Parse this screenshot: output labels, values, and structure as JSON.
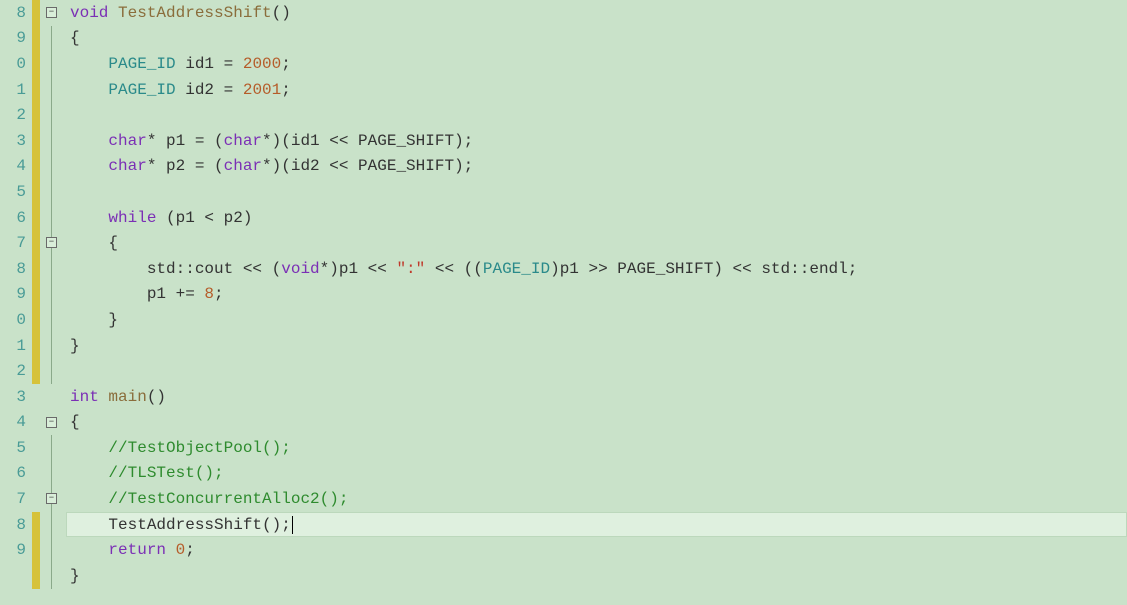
{
  "editor": {
    "line_height_px": 25.6,
    "font": "Consolas",
    "current_line_index": 21,
    "change_bar_ranges": [
      [
        0,
        14
      ],
      [
        20,
        22
      ]
    ],
    "fold_markers": [
      0,
      9,
      16,
      19
    ],
    "fold_line_ranges": [
      [
        1,
        14
      ],
      [
        10,
        13
      ],
      [
        17,
        23
      ],
      [
        20,
        23
      ]
    ],
    "lines": [
      {
        "no": "8",
        "tokens": [
          [
            "kw",
            "void"
          ],
          [
            "pun",
            " "
          ],
          [
            "func",
            "TestAddressShift"
          ],
          [
            "pun",
            "()"
          ]
        ]
      },
      {
        "no": "9",
        "tokens": [
          [
            "pun",
            "{"
          ]
        ]
      },
      {
        "no": "0",
        "tokens": [
          [
            "pun",
            "    "
          ],
          [
            "type",
            "PAGE_ID"
          ],
          [
            "pun",
            " id1 = "
          ],
          [
            "num",
            "2000"
          ],
          [
            "pun",
            ";"
          ]
        ]
      },
      {
        "no": "1",
        "tokens": [
          [
            "pun",
            "    "
          ],
          [
            "type",
            "PAGE_ID"
          ],
          [
            "pun",
            " id2 = "
          ],
          [
            "num",
            "2001"
          ],
          [
            "pun",
            ";"
          ]
        ]
      },
      {
        "no": "2",
        "tokens": []
      },
      {
        "no": "3",
        "tokens": [
          [
            "pun",
            "    "
          ],
          [
            "kw",
            "char"
          ],
          [
            "pun",
            "* p1 = ("
          ],
          [
            "kw",
            "char"
          ],
          [
            "pun",
            "*)(id1 << PAGE_SHIFT);"
          ]
        ]
      },
      {
        "no": "4",
        "tokens": [
          [
            "pun",
            "    "
          ],
          [
            "kw",
            "char"
          ],
          [
            "pun",
            "* p2 = ("
          ],
          [
            "kw",
            "char"
          ],
          [
            "pun",
            "*)(id2 << PAGE_SHIFT);"
          ]
        ]
      },
      {
        "no": "5",
        "tokens": []
      },
      {
        "no": "6",
        "tokens": [
          [
            "pun",
            "    "
          ],
          [
            "kw",
            "while"
          ],
          [
            "pun",
            " (p1 < p2)"
          ]
        ]
      },
      {
        "no": "7",
        "tokens": [
          [
            "pun",
            "    {"
          ]
        ]
      },
      {
        "no": "8",
        "tokens": [
          [
            "pun",
            "        std::cout << ("
          ],
          [
            "kw",
            "void"
          ],
          [
            "pun",
            "*)p1 << "
          ],
          [
            "str",
            "\":\""
          ],
          [
            "pun",
            " << (("
          ],
          [
            "type",
            "PAGE_ID"
          ],
          [
            "pun",
            ")p1 >> PAGE_SHIFT) << std::endl;"
          ]
        ]
      },
      {
        "no": "9",
        "tokens": [
          [
            "pun",
            "        p1 += "
          ],
          [
            "num",
            "8"
          ],
          [
            "pun",
            ";"
          ]
        ]
      },
      {
        "no": "0",
        "tokens": [
          [
            "pun",
            "    }"
          ]
        ]
      },
      {
        "no": "1",
        "tokens": [
          [
            "pun",
            "}"
          ]
        ]
      },
      {
        "no": "2",
        "tokens": []
      },
      {
        "no": "3",
        "tokens": [
          [
            "kw",
            "int"
          ],
          [
            "pun",
            " "
          ],
          [
            "func",
            "main"
          ],
          [
            "pun",
            "()"
          ]
        ]
      },
      {
        "no": "4",
        "tokens": [
          [
            "pun",
            "{"
          ]
        ]
      },
      {
        "no": "5",
        "tokens": [
          [
            "pun",
            "    "
          ],
          [
            "cmt",
            "//TestObjectPool();"
          ]
        ]
      },
      {
        "no": "6",
        "tokens": [
          [
            "pun",
            "    "
          ],
          [
            "cmt",
            "//TLSTest();"
          ]
        ]
      },
      {
        "no": "7",
        "tokens": [
          [
            "pun",
            "    "
          ],
          [
            "cmt",
            "//TestConcurrentAlloc2();"
          ]
        ]
      },
      {
        "no": "8",
        "tokens": [
          [
            "pun",
            "    TestAddressShift();"
          ]
        ],
        "caret": true
      },
      {
        "no": "9",
        "tokens": [
          [
            "pun",
            "    "
          ],
          [
            "kw",
            "return"
          ],
          [
            "pun",
            " "
          ],
          [
            "num",
            "0"
          ],
          [
            "pun",
            ";"
          ]
        ]
      },
      {
        "no": "",
        "tokens": [
          [
            "pun",
            "}"
          ]
        ]
      }
    ]
  }
}
